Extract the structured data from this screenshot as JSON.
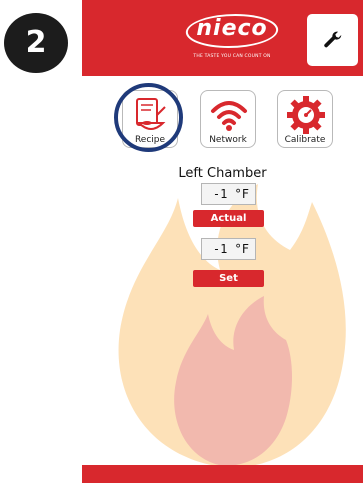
{
  "step": {
    "number": "2"
  },
  "header": {
    "logo_text": "nieco",
    "tagline": "THE TASTE YOU CAN COUNT ON",
    "settings_icon": "wrench-icon"
  },
  "nav": {
    "items": [
      {
        "label": "Recipe",
        "icon": "recipe-icon",
        "selected": true
      },
      {
        "label": "Network",
        "icon": "wifi-icon"
      },
      {
        "label": "Calibrate",
        "icon": "gauge-gear-icon"
      }
    ]
  },
  "chamber": {
    "title": "Left Chamber",
    "actual_value": "-1 °F",
    "actual_label": "Actual",
    "set_value": "-1 °F",
    "set_label": "Set"
  },
  "colors": {
    "brand_red": "#d8282d",
    "selection_ring": "#1f3a7a",
    "flame_outer": "#fde1b8",
    "flame_inner": "#f2b9ae"
  }
}
